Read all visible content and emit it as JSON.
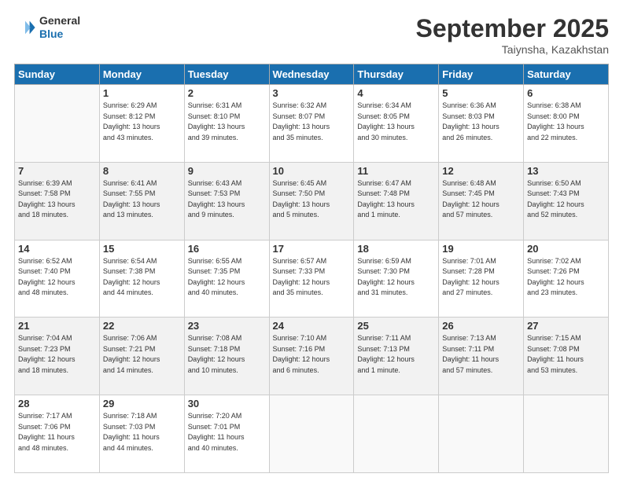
{
  "header": {
    "logo": {
      "general": "General",
      "blue": "Blue"
    },
    "title": "September 2025",
    "subtitle": "Taiynsha, Kazakhstan"
  },
  "days_header": [
    "Sunday",
    "Monday",
    "Tuesday",
    "Wednesday",
    "Thursday",
    "Friday",
    "Saturday"
  ],
  "weeks": [
    {
      "shade": "white",
      "days": [
        {
          "num": "",
          "info": ""
        },
        {
          "num": "1",
          "info": "Sunrise: 6:29 AM\nSunset: 8:12 PM\nDaylight: 13 hours\nand 43 minutes."
        },
        {
          "num": "2",
          "info": "Sunrise: 6:31 AM\nSunset: 8:10 PM\nDaylight: 13 hours\nand 39 minutes."
        },
        {
          "num": "3",
          "info": "Sunrise: 6:32 AM\nSunset: 8:07 PM\nDaylight: 13 hours\nand 35 minutes."
        },
        {
          "num": "4",
          "info": "Sunrise: 6:34 AM\nSunset: 8:05 PM\nDaylight: 13 hours\nand 30 minutes."
        },
        {
          "num": "5",
          "info": "Sunrise: 6:36 AM\nSunset: 8:03 PM\nDaylight: 13 hours\nand 26 minutes."
        },
        {
          "num": "6",
          "info": "Sunrise: 6:38 AM\nSunset: 8:00 PM\nDaylight: 13 hours\nand 22 minutes."
        }
      ]
    },
    {
      "shade": "shaded",
      "days": [
        {
          "num": "7",
          "info": "Sunrise: 6:39 AM\nSunset: 7:58 PM\nDaylight: 13 hours\nand 18 minutes."
        },
        {
          "num": "8",
          "info": "Sunrise: 6:41 AM\nSunset: 7:55 PM\nDaylight: 13 hours\nand 13 minutes."
        },
        {
          "num": "9",
          "info": "Sunrise: 6:43 AM\nSunset: 7:53 PM\nDaylight: 13 hours\nand 9 minutes."
        },
        {
          "num": "10",
          "info": "Sunrise: 6:45 AM\nSunset: 7:50 PM\nDaylight: 13 hours\nand 5 minutes."
        },
        {
          "num": "11",
          "info": "Sunrise: 6:47 AM\nSunset: 7:48 PM\nDaylight: 13 hours\nand 1 minute."
        },
        {
          "num": "12",
          "info": "Sunrise: 6:48 AM\nSunset: 7:45 PM\nDaylight: 12 hours\nand 57 minutes."
        },
        {
          "num": "13",
          "info": "Sunrise: 6:50 AM\nSunset: 7:43 PM\nDaylight: 12 hours\nand 52 minutes."
        }
      ]
    },
    {
      "shade": "white",
      "days": [
        {
          "num": "14",
          "info": "Sunrise: 6:52 AM\nSunset: 7:40 PM\nDaylight: 12 hours\nand 48 minutes."
        },
        {
          "num": "15",
          "info": "Sunrise: 6:54 AM\nSunset: 7:38 PM\nDaylight: 12 hours\nand 44 minutes."
        },
        {
          "num": "16",
          "info": "Sunrise: 6:55 AM\nSunset: 7:35 PM\nDaylight: 12 hours\nand 40 minutes."
        },
        {
          "num": "17",
          "info": "Sunrise: 6:57 AM\nSunset: 7:33 PM\nDaylight: 12 hours\nand 35 minutes."
        },
        {
          "num": "18",
          "info": "Sunrise: 6:59 AM\nSunset: 7:30 PM\nDaylight: 12 hours\nand 31 minutes."
        },
        {
          "num": "19",
          "info": "Sunrise: 7:01 AM\nSunset: 7:28 PM\nDaylight: 12 hours\nand 27 minutes."
        },
        {
          "num": "20",
          "info": "Sunrise: 7:02 AM\nSunset: 7:26 PM\nDaylight: 12 hours\nand 23 minutes."
        }
      ]
    },
    {
      "shade": "shaded",
      "days": [
        {
          "num": "21",
          "info": "Sunrise: 7:04 AM\nSunset: 7:23 PM\nDaylight: 12 hours\nand 18 minutes."
        },
        {
          "num": "22",
          "info": "Sunrise: 7:06 AM\nSunset: 7:21 PM\nDaylight: 12 hours\nand 14 minutes."
        },
        {
          "num": "23",
          "info": "Sunrise: 7:08 AM\nSunset: 7:18 PM\nDaylight: 12 hours\nand 10 minutes."
        },
        {
          "num": "24",
          "info": "Sunrise: 7:10 AM\nSunset: 7:16 PM\nDaylight: 12 hours\nand 6 minutes."
        },
        {
          "num": "25",
          "info": "Sunrise: 7:11 AM\nSunset: 7:13 PM\nDaylight: 12 hours\nand 1 minute."
        },
        {
          "num": "26",
          "info": "Sunrise: 7:13 AM\nSunset: 7:11 PM\nDaylight: 11 hours\nand 57 minutes."
        },
        {
          "num": "27",
          "info": "Sunrise: 7:15 AM\nSunset: 7:08 PM\nDaylight: 11 hours\nand 53 minutes."
        }
      ]
    },
    {
      "shade": "white",
      "days": [
        {
          "num": "28",
          "info": "Sunrise: 7:17 AM\nSunset: 7:06 PM\nDaylight: 11 hours\nand 48 minutes."
        },
        {
          "num": "29",
          "info": "Sunrise: 7:18 AM\nSunset: 7:03 PM\nDaylight: 11 hours\nand 44 minutes."
        },
        {
          "num": "30",
          "info": "Sunrise: 7:20 AM\nSunset: 7:01 PM\nDaylight: 11 hours\nand 40 minutes."
        },
        {
          "num": "",
          "info": ""
        },
        {
          "num": "",
          "info": ""
        },
        {
          "num": "",
          "info": ""
        },
        {
          "num": "",
          "info": ""
        }
      ]
    }
  ]
}
